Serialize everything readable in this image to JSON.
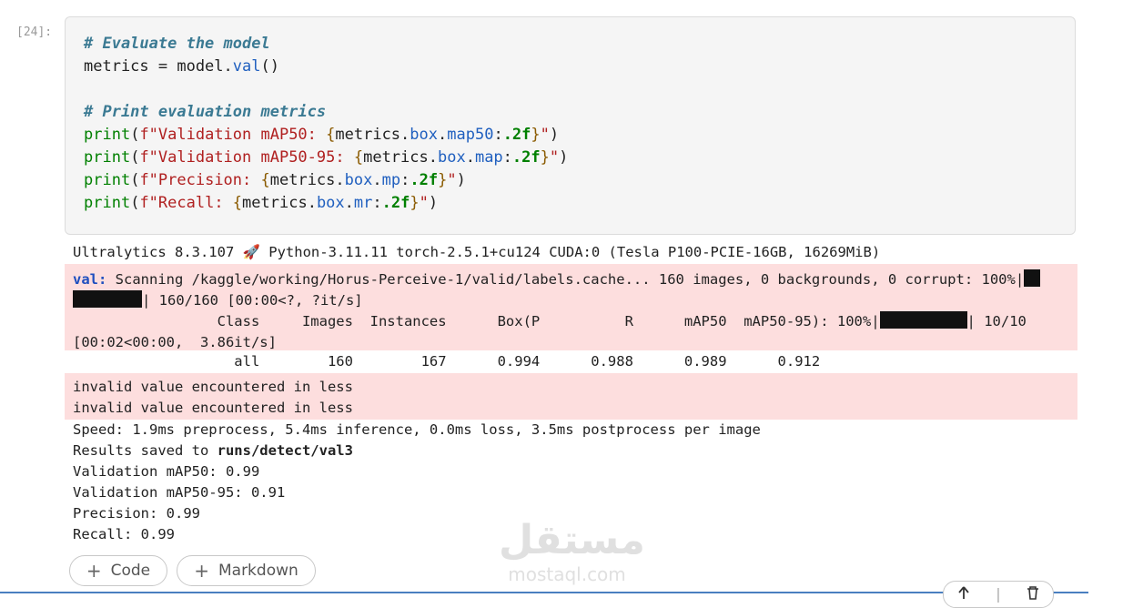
{
  "cell": {
    "prompt": "[24]:",
    "code_lines": [
      [
        {
          "t": "# Evaluate the model",
          "c": "c-comment"
        }
      ],
      [
        {
          "t": "metrics = model."
        },
        {
          "t": "val",
          "c": "c-attr"
        },
        {
          "t": "()"
        }
      ],
      [
        {
          "t": ""
        }
      ],
      [
        {
          "t": "# Print evaluation metrics",
          "c": "c-comment"
        }
      ],
      [
        {
          "t": "print",
          "c": "c-print"
        },
        {
          "t": "("
        },
        {
          "t": "f\"Validation mAP50: ",
          "c": "c-str"
        },
        {
          "t": "{",
          "c": "c-brace"
        },
        {
          "t": "metrics."
        },
        {
          "t": "box",
          "c": "c-attr"
        },
        {
          "t": "."
        },
        {
          "t": "map50",
          "c": "c-attr"
        },
        {
          "t": ":"
        },
        {
          "t": ".2f",
          "c": "c-fmt"
        },
        {
          "t": "}",
          "c": "c-brace"
        },
        {
          "t": "\"",
          "c": "c-str"
        },
        {
          "t": ")"
        }
      ],
      [
        {
          "t": "print",
          "c": "c-print"
        },
        {
          "t": "("
        },
        {
          "t": "f\"Validation mAP50-95: ",
          "c": "c-str"
        },
        {
          "t": "{",
          "c": "c-brace"
        },
        {
          "t": "metrics."
        },
        {
          "t": "box",
          "c": "c-attr"
        },
        {
          "t": "."
        },
        {
          "t": "map",
          "c": "c-attr"
        },
        {
          "t": ":"
        },
        {
          "t": ".2f",
          "c": "c-fmt"
        },
        {
          "t": "}",
          "c": "c-brace"
        },
        {
          "t": "\"",
          "c": "c-str"
        },
        {
          "t": ")"
        }
      ],
      [
        {
          "t": "print",
          "c": "c-print"
        },
        {
          "t": "("
        },
        {
          "t": "f\"Precision: ",
          "c": "c-str"
        },
        {
          "t": "{",
          "c": "c-brace"
        },
        {
          "t": "metrics."
        },
        {
          "t": "box",
          "c": "c-attr"
        },
        {
          "t": "."
        },
        {
          "t": "mp",
          "c": "c-attr"
        },
        {
          "t": ":"
        },
        {
          "t": ".2f",
          "c": "c-fmt"
        },
        {
          "t": "}",
          "c": "c-brace"
        },
        {
          "t": "\"",
          "c": "c-str"
        },
        {
          "t": ")"
        }
      ],
      [
        {
          "t": "print",
          "c": "c-print"
        },
        {
          "t": "("
        },
        {
          "t": "f\"Recall: ",
          "c": "c-str"
        },
        {
          "t": "{",
          "c": "c-brace"
        },
        {
          "t": "metrics."
        },
        {
          "t": "box",
          "c": "c-attr"
        },
        {
          "t": "."
        },
        {
          "t": "mr",
          "c": "c-attr"
        },
        {
          "t": ":"
        },
        {
          "t": ".2f",
          "c": "c-fmt"
        },
        {
          "t": "}",
          "c": "c-brace"
        },
        {
          "t": "\"",
          "c": "c-str"
        },
        {
          "t": ")"
        }
      ]
    ]
  },
  "output": {
    "env_line": "Ultralytics 8.3.107 🚀 Python-3.11.11 torch-2.5.1+cu124 CUDA:0 (Tesla P100-PCIE-16GB, 16269MiB)",
    "scan_label": "val:",
    "scan_text": " Scanning /kaggle/working/Horus-Perceive-1/valid/labels.cache... 160 images, 0 backgrounds, 0 corrupt: 100%|",
    "scan_progress_tail": "| 160/160 [00:00<?, ?it/s]",
    "header_line": "                 Class     Images  Instances      Box(P          R      mAP50  mAP50-95): 100%|",
    "header_progress_tail": "| 10/10",
    "header_time": "[00:02<00:00,  3.86it/s]",
    "results_line": "                   all        160        167      0.994      0.988      0.989      0.912",
    "warnings": [
      "invalid value encountered in less",
      "invalid value encountered in less"
    ],
    "speed_line": "Speed: 1.9ms preprocess, 5.4ms inference, 0.0ms loss, 3.5ms postprocess per image",
    "saved_prefix": "Results saved to ",
    "saved_path": "runs/detect/val3",
    "metrics": [
      "Validation mAP50: 0.99",
      "Validation mAP50-95: 0.91",
      "Precision: 0.99",
      "Recall: 0.99"
    ],
    "progress_complete": 1.0
  },
  "buttons": {
    "add_code": "Code",
    "add_markdown": "Markdown"
  },
  "toolbar": {
    "up_icon": "arrow-up-icon",
    "delete_icon": "trash-icon"
  },
  "watermark": {
    "arabic": "مستقل",
    "latin": "mostaql.com"
  }
}
